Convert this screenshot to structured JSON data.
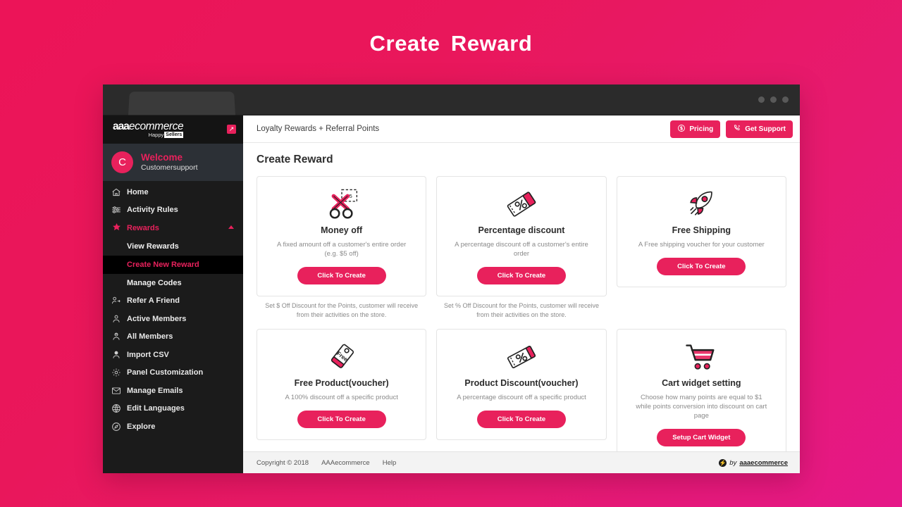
{
  "banner": {
    "title": "Create  Reward"
  },
  "browser": {
    "dots_count": 3
  },
  "sidebar": {
    "brand": {
      "name_bold": "aaa",
      "name_italic": "ecommerce",
      "tagline_first": "Happy",
      "tagline_boxed": "Sellers",
      "collapse_icon": "expand-arrow-icon"
    },
    "user": {
      "avatar_letter": "C",
      "welcome": "Welcome",
      "username": "Customersupport"
    },
    "items": [
      {
        "label": "Home",
        "icon": "home-icon",
        "active": false
      },
      {
        "label": "Activity Rules",
        "icon": "sliders-icon",
        "active": false
      },
      {
        "label": "Rewards",
        "icon": "star-icon",
        "active": true,
        "expanded": true
      },
      {
        "label": "Refer A Friend",
        "icon": "user-share-icon",
        "active": false
      },
      {
        "label": "Active Members",
        "icon": "user-icon",
        "active": false
      },
      {
        "label": "All Members",
        "icon": "users-icon",
        "active": false
      },
      {
        "label": "Import CSV",
        "icon": "user-import-icon",
        "active": false
      },
      {
        "label": "Panel Customization",
        "icon": "gear-icon",
        "active": false
      },
      {
        "label": "Manage Emails",
        "icon": "envelope-icon",
        "active": false
      },
      {
        "label": "Edit Languages",
        "icon": "globe-icon",
        "active": false
      },
      {
        "label": "Explore",
        "icon": "compass-icon",
        "active": false
      }
    ],
    "sub_items": [
      {
        "label": "View Rewards",
        "current": false
      },
      {
        "label": "Create New Reward",
        "current": true
      },
      {
        "label": "Manage Codes",
        "current": false
      }
    ]
  },
  "topbar": {
    "title": "Loyalty Rewards + Referral Points",
    "pricing_label": "Pricing",
    "pricing_icon": "dollar-circle-icon",
    "support_label": "Get Support",
    "support_icon": "phone-ring-icon"
  },
  "main": {
    "page_title": "Create Reward",
    "cards": [
      {
        "icon": "scissors-coupon-icon",
        "title": "Money off",
        "desc": "A fixed amount off a customer's entire order (e.g. $5 off)",
        "cta": "Click To Create",
        "note": "Set $ Off Discount for the Points, customer will receive from their activities on the store."
      },
      {
        "icon": "percent-ticket-icon",
        "title": "Percentage discount",
        "desc": "A percentage discount off a customer's entire order",
        "cta": "Click To Create",
        "note": "Set % Off Discount for the Points, customer will receive from their activities on the store."
      },
      {
        "icon": "rocket-icon",
        "title": "Free Shipping",
        "desc": "A Free shipping voucher for your customer",
        "cta": "Click To Create",
        "note": ""
      },
      {
        "icon": "free-tag-icon",
        "title": "Free Product(voucher)",
        "desc": "A 100% discount off a specific product",
        "cta": "Click To Create",
        "note": ""
      },
      {
        "icon": "percent-ticket-icon",
        "title": "Product Discount(voucher)",
        "desc": "A percentage discount off a specific product",
        "cta": "Click To Create",
        "note": ""
      },
      {
        "icon": "shopping-cart-icon",
        "title": "Cart widget setting",
        "desc": "Choose how many points are equal to $1 while points conversion into discount on cart page",
        "cta": "Setup Cart Widget",
        "note": ""
      }
    ]
  },
  "footer": {
    "copyright": "Copyright © 2018",
    "company_link": "AAAecommerce",
    "help_link": "Help",
    "brand_by": "by",
    "brand_name": "aaaecommerce"
  },
  "colors": {
    "accent": "#e8215c",
    "page_background": "#e9175b",
    "sidebar": "#1b1b1b",
    "userbox": "#2c3036"
  }
}
